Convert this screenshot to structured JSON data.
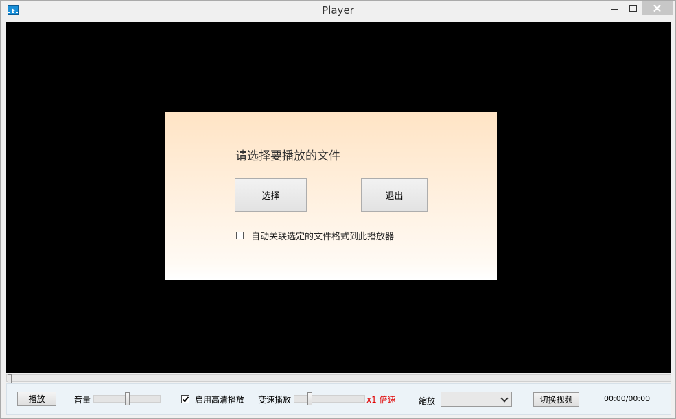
{
  "window": {
    "title": "Player"
  },
  "dialog": {
    "prompt": "请选择要播放的文件",
    "select_label": "选择",
    "exit_label": "退出",
    "associate_label": "自动关联选定的文件格式到此播放器",
    "associate_checked": false
  },
  "seek": {
    "position": 0
  },
  "controls": {
    "play_label": "播放",
    "volume_label": "音量",
    "volume_level": 0.5,
    "hd_label": "启用高清播放",
    "hd_checked": true,
    "speed_label": "变速播放",
    "speed_level": 0.2,
    "speed_value": "x1 倍速",
    "zoom_label": "缩放",
    "zoom_value": "",
    "switch_label": "切换视频",
    "time": "00:00/00:00"
  },
  "colors": {
    "speed_text": "#e00000",
    "video_bg": "#000000"
  }
}
